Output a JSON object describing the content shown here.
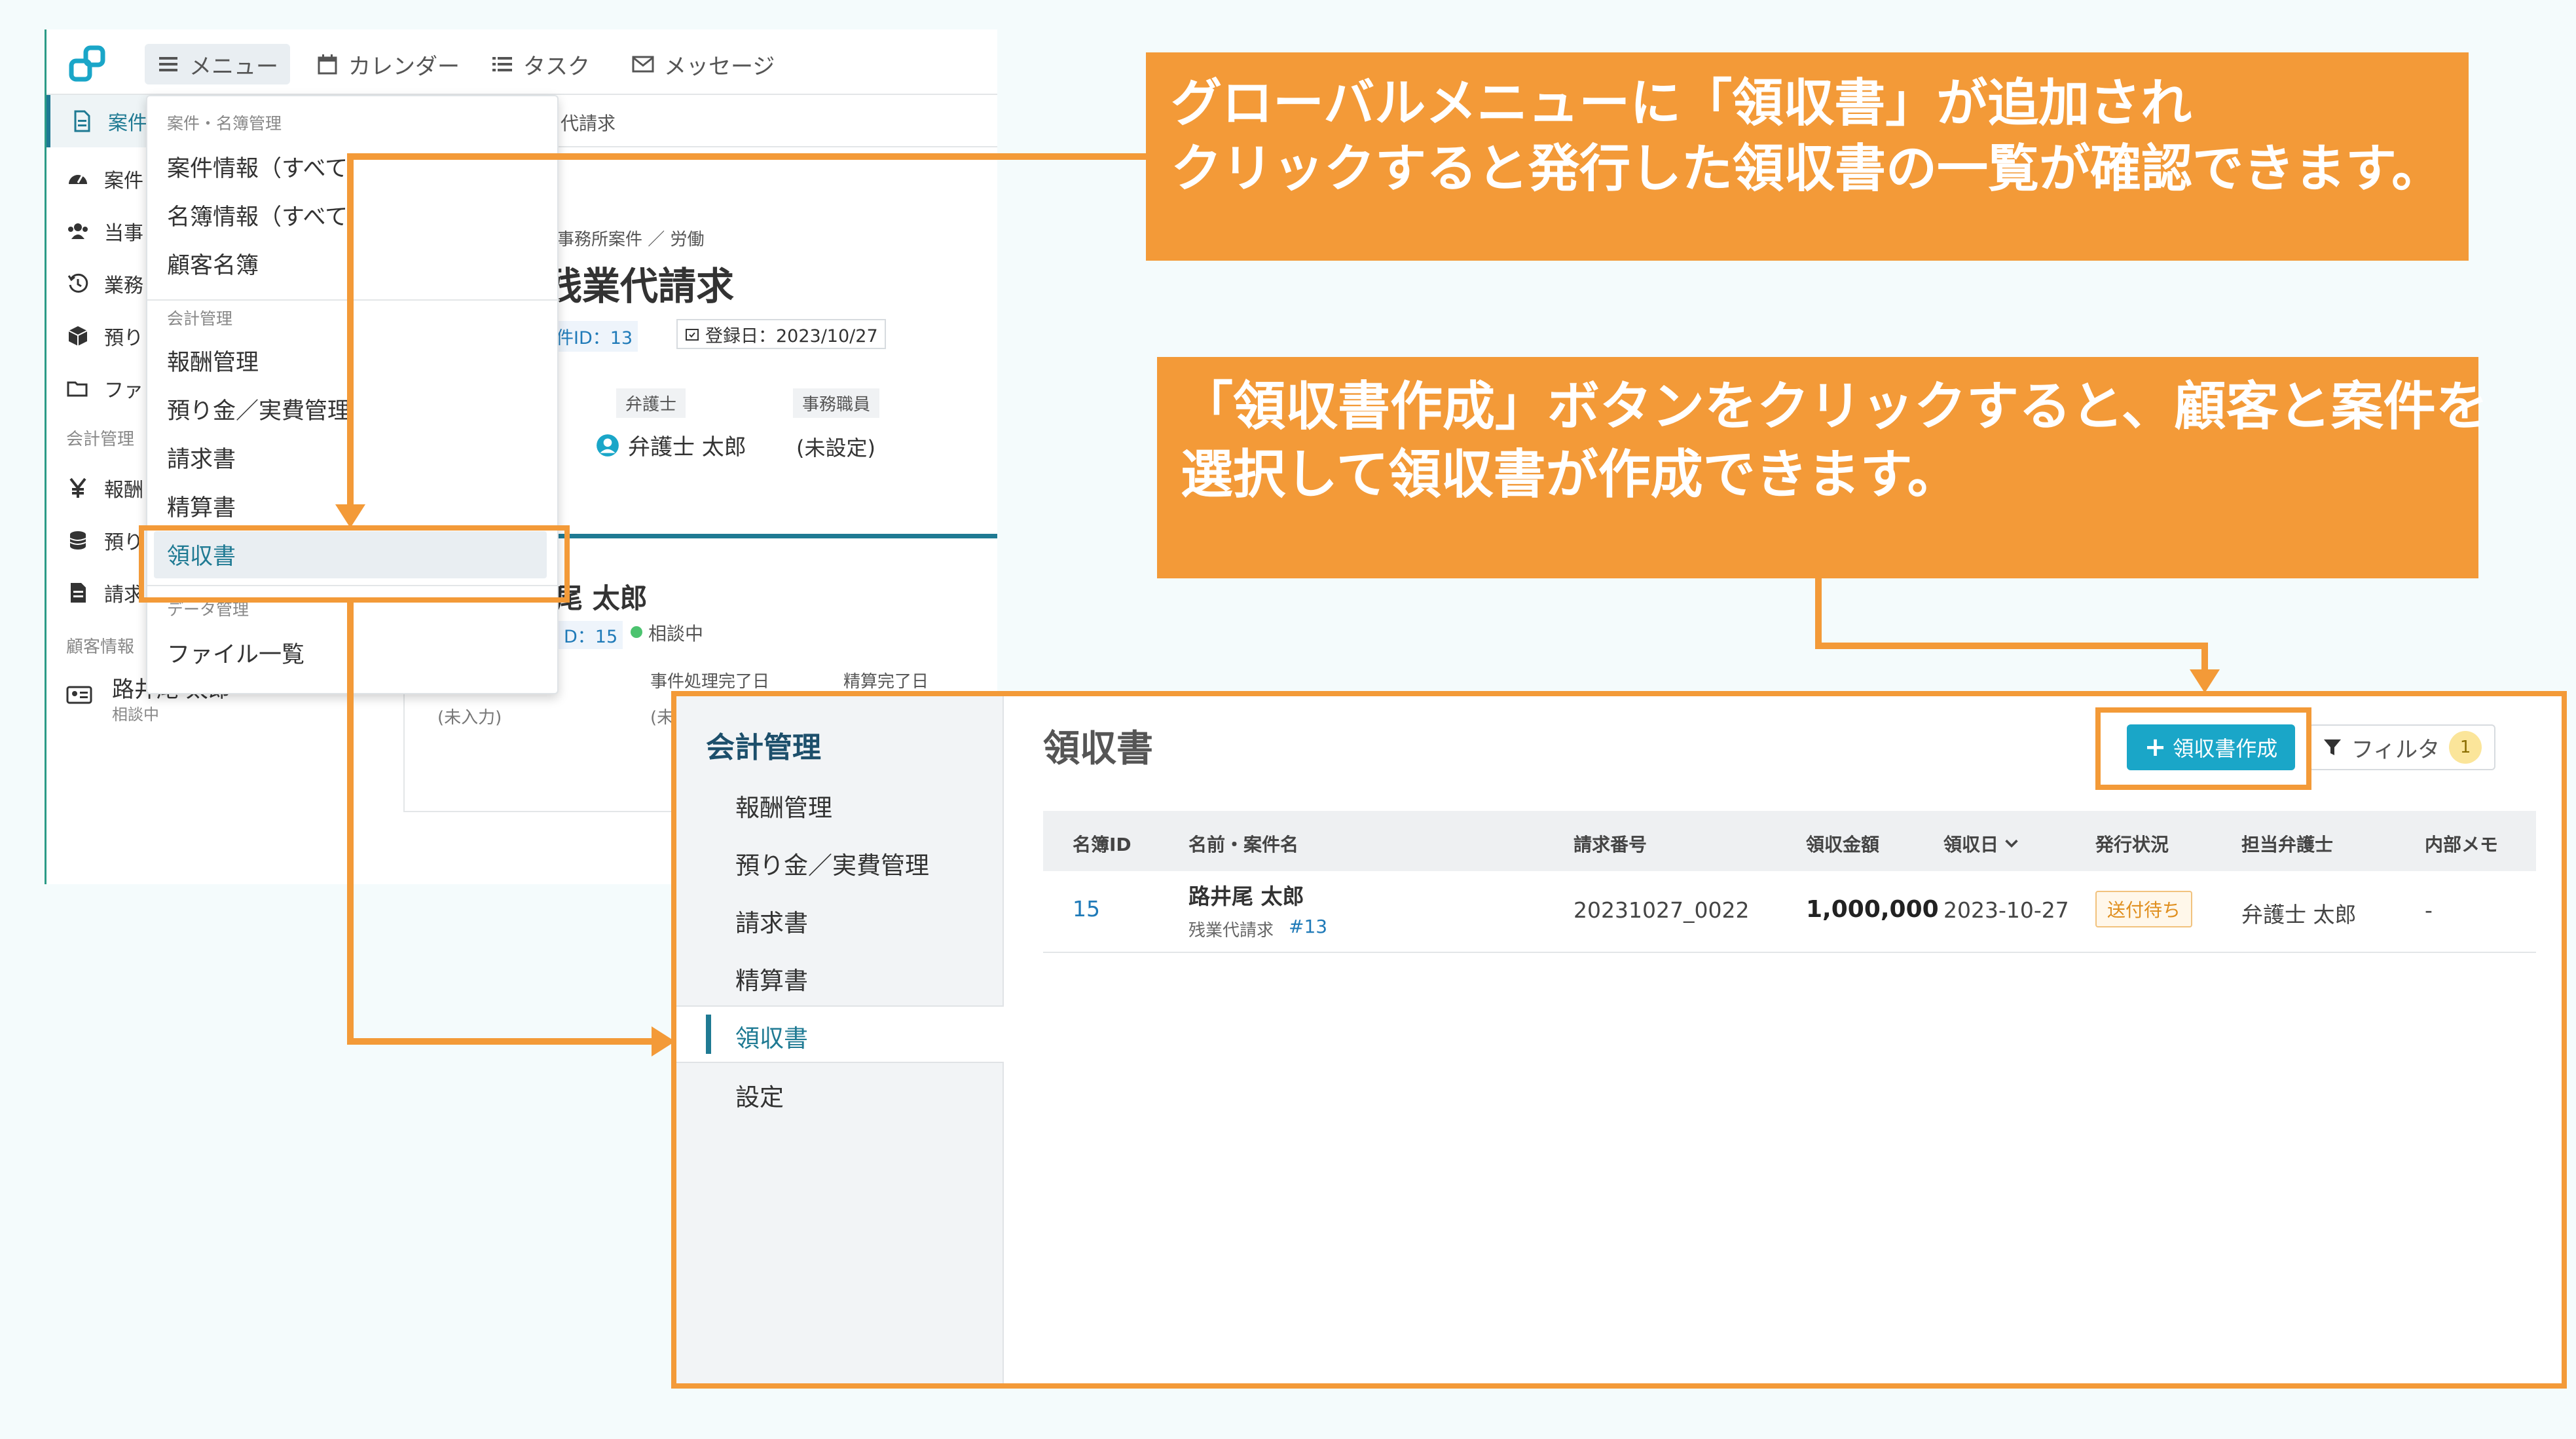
{
  "app1": {
    "nav": {
      "menu": "メニュー",
      "calendar": "カレンダー",
      "task": "タスク",
      "message": "メッセージ"
    },
    "sidebar": {
      "items": [
        "案件",
        "案件",
        "当事",
        "業務",
        "預り",
        "ファ"
      ],
      "section_accounting": "会計管理",
      "acct_items": [
        "報酬",
        "預り",
        "請求"
      ],
      "section_customer": "顧客情報",
      "customer_name": "路井尾 太郎",
      "customer_status": "相談中"
    },
    "dropdown": {
      "sec_case": "案件・名簿管理",
      "case_info": "案件情報（すべて",
      "roster_info": "名簿情報（すべて",
      "customer_roster": "顧客名簿",
      "sec_accounting": "会計管理",
      "fees": "報酬管理",
      "deposits": "預り金／実費管理",
      "invoice": "請求書",
      "settlement": "精算書",
      "receipt": "領収書",
      "sec_data": "データ管理",
      "files": "ファイル一覧"
    },
    "case": {
      "breadcrumb_tail": "代請求",
      "category": "事務所案件 ／ 労働",
      "title": "残業代請求",
      "id_label": "件ID：13",
      "registered": "登録日：2023/10/27",
      "lawyer_label": "弁護士",
      "lawyer_name": "弁護士 太郎",
      "staff_label": "事務職員",
      "staff_value": "(未設定)",
      "client_name": "尾 太郎",
      "client_id": "D：15",
      "client_status": "相談中",
      "col1": "(未入力)",
      "col2_label": "事件処理完了日",
      "col2_value": "(未入",
      "col3_label": "精算完了日"
    }
  },
  "callouts": {
    "top_line1": "グローバルメニューに「領収書」が追加され",
    "top_line2": "クリックすると発行した領収書の一覧が確認できます。",
    "mid_line1": "「領収書作成」ボタンをクリックすると、顧客と案件を",
    "mid_line2": "選択して領収書が作成できます。"
  },
  "app2": {
    "sidebar_title": "会計管理",
    "sidebar_items": [
      "報酬管理",
      "預り金／実費管理",
      "請求書",
      "精算書",
      "領収書",
      "設定"
    ],
    "page_title": "領収書",
    "create_button": "領収書作成",
    "filter_button": "フィルタ",
    "filter_count": "1",
    "columns": [
      "名簿ID",
      "名前・案件名",
      "請求番号",
      "領収金額",
      "領収日",
      "発行状況",
      "担当弁護士",
      "内部メモ"
    ],
    "rows": [
      {
        "roster_id": "15",
        "name": "路井尾 太郎",
        "case_name": "残業代請求",
        "case_no": "#13",
        "invoice_no": "20231027_0022",
        "amount": "1,000,000",
        "date": "2023-10-27",
        "status": "送付待ち",
        "lawyer": "弁護士 太郎",
        "memo": "-"
      }
    ]
  },
  "colors": {
    "accent_orange": "#f39a38",
    "brand_teal": "#1aa6c8",
    "link_blue": "#1f7ab8"
  }
}
